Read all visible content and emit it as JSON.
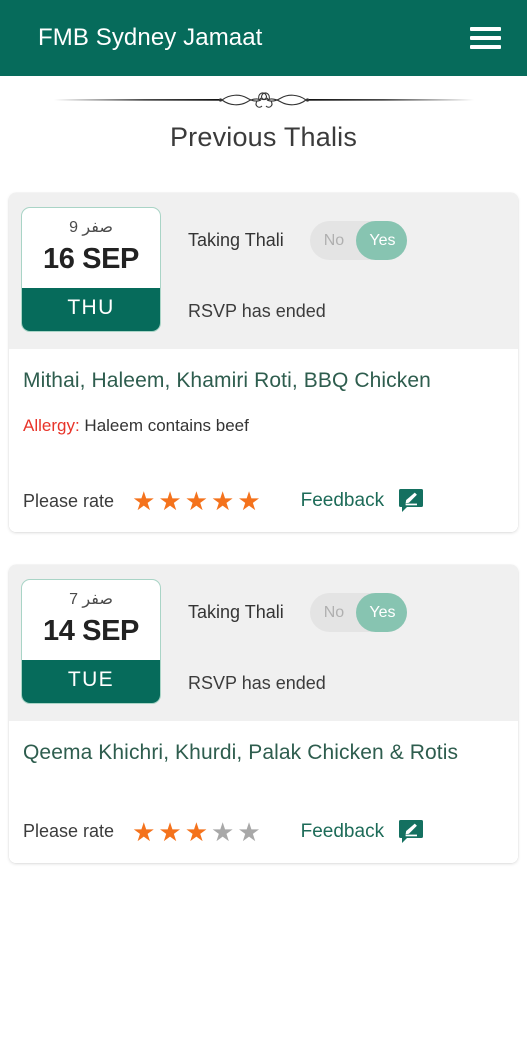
{
  "header": {
    "title": "FMB Sydney Jamaat",
    "menu_icon": "hamburger-menu-icon"
  },
  "page": {
    "title": "Previous Thalis",
    "divider_icon": "ornamental-flourish-divider"
  },
  "toggle_options": {
    "no": "No",
    "yes": "Yes"
  },
  "labels": {
    "taking_thali": "Taking Thali",
    "rsvp_status": "RSVP has ended",
    "please_rate": "Please rate",
    "feedback": "Feedback",
    "allergy_prefix": "Allergy:",
    "feedback_icon": "edit-comment-icon"
  },
  "theme": {
    "appbar_green": "#066b5b",
    "menu_green": "#2e5d4e",
    "toggle_on_green": "#87c4b1",
    "star_orange": "#f4721c",
    "star_grey": "#a8a8a8",
    "allergy_red": "#e8342a",
    "card_head_grey": "#f0f0f0"
  },
  "thalis": [
    {
      "hijri_date": "صفر 9",
      "gregorian_date": "16 SEP",
      "weekday": "THU",
      "taking_thali": "Yes",
      "rsvp_status": "RSVP has ended",
      "menu": "Mithai, Haleem, Khamiri Roti, BBQ Chicken",
      "allergy_label": "Allergy:",
      "allergy_text": "Haleem contains beef",
      "has_allergy": true,
      "rating": 5,
      "max_rating": 5
    },
    {
      "hijri_date": "صفر 7",
      "gregorian_date": "14 SEP",
      "weekday": "TUE",
      "taking_thali": "Yes",
      "rsvp_status": "RSVP has ended",
      "menu": "Qeema Khichri, Khurdi, Palak Chicken & Rotis",
      "allergy_label": "",
      "allergy_text": "",
      "has_allergy": false,
      "rating": 3,
      "max_rating": 5
    }
  ]
}
